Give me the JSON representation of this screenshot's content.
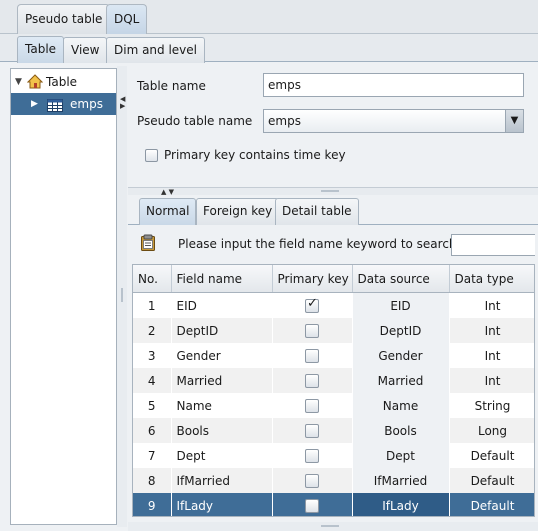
{
  "top_tabs": [
    {
      "label": "Pseudo table",
      "active": false
    },
    {
      "label": "DQL",
      "active": true
    }
  ],
  "sub_tabs": [
    {
      "label": "Table",
      "active": true
    },
    {
      "label": "View",
      "active": false
    },
    {
      "label": "Dim and level",
      "active": false
    }
  ],
  "tree": {
    "root_label": "Table",
    "children": [
      {
        "label": "emps",
        "selected": true
      }
    ]
  },
  "form": {
    "table_name_label": "Table name",
    "table_name_value": "emps",
    "pseudo_label": "Pseudo table name",
    "pseudo_value": "emps",
    "pk_time_label": "Primary key contains time key",
    "pk_time_checked": false
  },
  "inner_tabs": [
    {
      "label": "Normal",
      "active": true
    },
    {
      "label": "Foreign key",
      "active": false
    },
    {
      "label": "Detail table",
      "active": false
    }
  ],
  "search": {
    "label": "Please input the field name keyword to search:",
    "value": ""
  },
  "table": {
    "columns": [
      "No.",
      "Field name",
      "Primary key",
      "Data source",
      "Data type"
    ],
    "rows": [
      {
        "no": "1",
        "field": "EID",
        "pk": true,
        "source": "EID",
        "type": "Int"
      },
      {
        "no": "2",
        "field": "DeptID",
        "pk": false,
        "source": "DeptID",
        "type": "Int"
      },
      {
        "no": "3",
        "field": "Gender",
        "pk": false,
        "source": "Gender",
        "type": "Int"
      },
      {
        "no": "4",
        "field": "Married",
        "pk": false,
        "source": "Married",
        "type": "Int"
      },
      {
        "no": "5",
        "field": "Name",
        "pk": false,
        "source": "Name",
        "type": "String"
      },
      {
        "no": "6",
        "field": "Bools",
        "pk": false,
        "source": "Bools",
        "type": "Long"
      },
      {
        "no": "7",
        "field": "Dept",
        "pk": false,
        "source": "Dept",
        "type": "Default"
      },
      {
        "no": "8",
        "field": "IfMarried",
        "pk": false,
        "source": "IfMarried",
        "type": "Default"
      },
      {
        "no": "9",
        "field": "IfLady",
        "pk": false,
        "source": "IfLady",
        "type": "Default"
      }
    ],
    "selected_row": 9
  },
  "colors": {
    "selection": "#3f6d97",
    "selection_alt": "#2f5c87",
    "tab_active": "#c9d8e7"
  },
  "icons": [
    "home-icon",
    "table-icon",
    "expand-arrow-icon",
    "collapse-arrow-icon",
    "clipboard-search-icon",
    "dropdown-arrow-icon"
  ]
}
